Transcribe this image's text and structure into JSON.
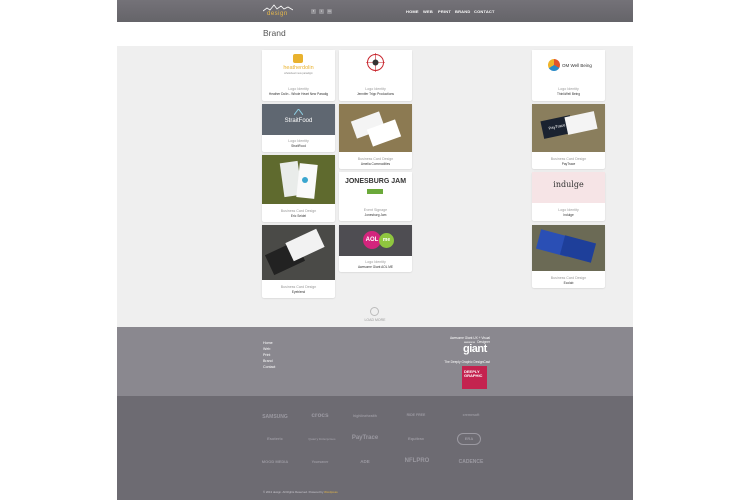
{
  "header": {
    "logo_text": "design",
    "social": [
      "f",
      "t",
      "in"
    ],
    "nav": [
      "HOME",
      "WEB",
      "PRINT",
      "BRAND",
      "CONTACT"
    ]
  },
  "page_title": "Brand",
  "cards": [
    {
      "caption": "Logo Identity",
      "sub": "Heather Dolin - Whole Heart New Paradig"
    },
    {
      "caption": "Logo Identity",
      "sub": "Jennifer Tripp Productions"
    },
    {
      "caption": "Logo Identity",
      "sub": "ThinkWell Being"
    },
    {
      "caption": "Logo Identity",
      "sub": "StraitFood"
    },
    {
      "caption": "Business Card Design",
      "sub": "Amelia Commodities"
    },
    {
      "caption": "Business Card Design",
      "sub": "PayTrace"
    },
    {
      "caption": "Business Card Design",
      "sub": "Eric Seidel"
    },
    {
      "caption": "Event Signage",
      "sub": "Jonesburg Jam"
    },
    {
      "caption": "Logo Identity",
      "sub": "Indulge"
    },
    {
      "caption": "Business Card Design",
      "sub": "Eyeblend"
    },
    {
      "caption": "Logo Identity",
      "sub": "Awesome Giant AOL ME"
    },
    {
      "caption": "Business Card Design",
      "sub": "Ecolab"
    }
  ],
  "thumbs": {
    "heather": "heatherdolin",
    "heather_sub": "wholeheart new paradigm",
    "thinkwell": "OM Well Being",
    "straitfood": "StraitFood",
    "paytrace": "PayTrace",
    "jonesburg": "JONESBURG JAM",
    "indulge": "indulge",
    "aol": "AOL",
    "me": "me"
  },
  "load_more": "LOAD MORE",
  "footer": {
    "links": [
      "Home",
      "Web",
      "Print",
      "Brand",
      "Contact"
    ],
    "note1": "Awesome Giant UX + Visual Designer",
    "giant_small": "awesome",
    "giant": "giant",
    "note2": "The Deeply Graphic DesignCast",
    "deeply": "DEEPLY GRAPHIC"
  },
  "clients": [
    "SAMSUNG",
    "crocs",
    "highlinehealth",
    "RIDE FREE",
    "cremesoft",
    "Esoteric",
    "Quarry Enterprises",
    "PayTrace",
    "Equitrax",
    "ERA",
    "MOOD MEDIA",
    "Yoursaver",
    "ADE",
    "NFLPRO",
    "CADENCE"
  ],
  "copyright_main": "© 2013 design. All Rights Reserved. Powered by",
  "copyright_link": "Wordpress"
}
